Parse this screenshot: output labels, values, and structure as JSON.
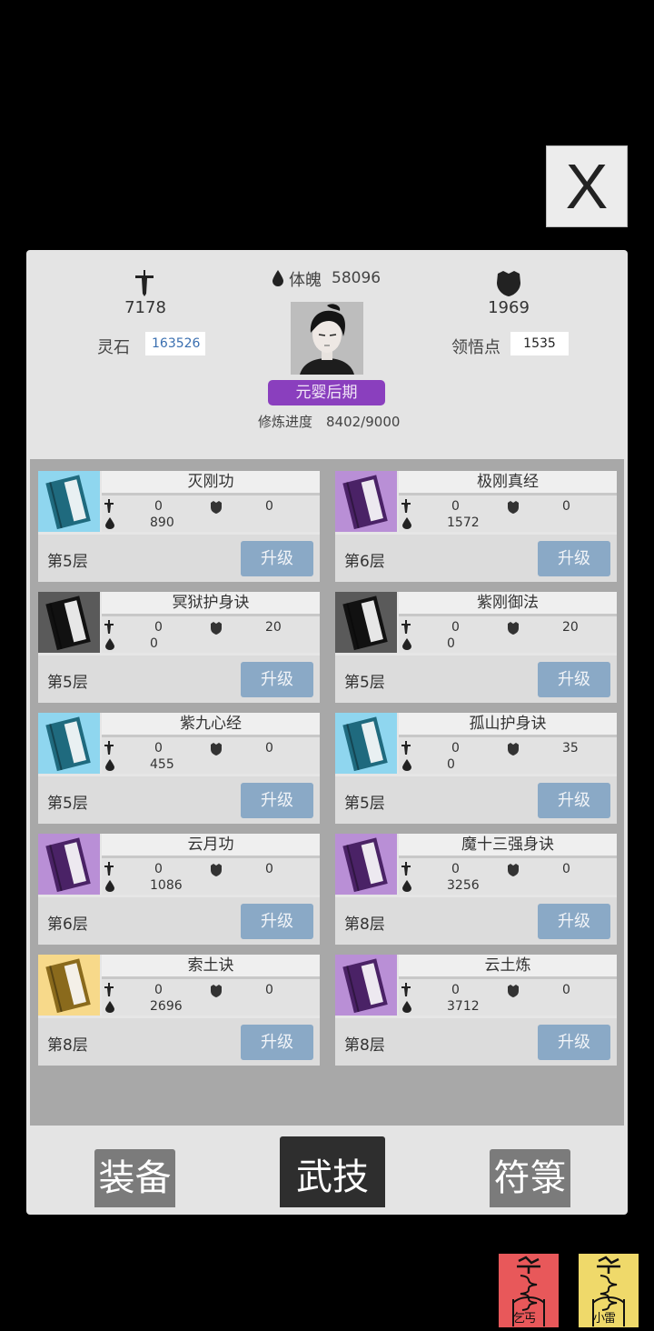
{
  "close_button": {
    "label": "X"
  },
  "stats": {
    "attack_value": "7178",
    "physique_label": "体魄",
    "physique_value": "58096",
    "defense_value": "1969",
    "spirit_stone_label": "灵石",
    "spirit_stone_value": "163526",
    "insight_label": "领悟点",
    "insight_value": "1535"
  },
  "realm": {
    "label": "元婴后期"
  },
  "progress": {
    "label": "修炼进度",
    "value": "8402/9000"
  },
  "skills": [
    {
      "name": "灭刚功",
      "attack": "0",
      "defense": "0",
      "hp": "890",
      "level": "第5层",
      "upgrade": "升级",
      "color": "#8fd6ef",
      "book": "#1f6a7e"
    },
    {
      "name": "极刚真经",
      "attack": "0",
      "defense": "0",
      "hp": "1572",
      "level": "第6层",
      "upgrade": "升级",
      "color": "#b98fd6",
      "book": "#4a2266"
    },
    {
      "name": "冥狱护身诀",
      "attack": "0",
      "defense": "20",
      "hp": "0",
      "level": "第5层",
      "upgrade": "升级",
      "color": "#5a5a5a",
      "book": "#111111"
    },
    {
      "name": "紫刚御法",
      "attack": "0",
      "defense": "20",
      "hp": "0",
      "level": "第5层",
      "upgrade": "升级",
      "color": "#5a5a5a",
      "book": "#111111"
    },
    {
      "name": "紫九心经",
      "attack": "0",
      "defense": "0",
      "hp": "455",
      "level": "第5层",
      "upgrade": "升级",
      "color": "#8fd6ef",
      "book": "#1f6a7e"
    },
    {
      "name": "孤山护身诀",
      "attack": "0",
      "defense": "35",
      "hp": "0",
      "level": "第5层",
      "upgrade": "升级",
      "color": "#8fd6ef",
      "book": "#1f6a7e"
    },
    {
      "name": "云月功",
      "attack": "0",
      "defense": "0",
      "hp": "1086",
      "level": "第6层",
      "upgrade": "升级",
      "color": "#b98fd6",
      "book": "#4a2266"
    },
    {
      "name": "魔十三强身诀",
      "attack": "0",
      "defense": "0",
      "hp": "3256",
      "level": "第8层",
      "upgrade": "升级",
      "color": "#b98fd6",
      "book": "#4a2266"
    },
    {
      "name": "索土诀",
      "attack": "0",
      "defense": "0",
      "hp": "2696",
      "level": "第8层",
      "upgrade": "升级",
      "color": "#f7d98a",
      "book": "#8a6a1c"
    },
    {
      "name": "云土炼",
      "attack": "0",
      "defense": "0",
      "hp": "3712",
      "level": "第8层",
      "upgrade": "升级",
      "color": "#b98fd6",
      "book": "#4a2266"
    }
  ],
  "tabs": {
    "equipment": "装备",
    "skills": "武技",
    "talisman": "符箓"
  },
  "charms": {
    "red": {
      "label": "乞丐",
      "color": "#e8585a"
    },
    "yellow": {
      "label": "小雷",
      "color": "#efd96a"
    }
  }
}
